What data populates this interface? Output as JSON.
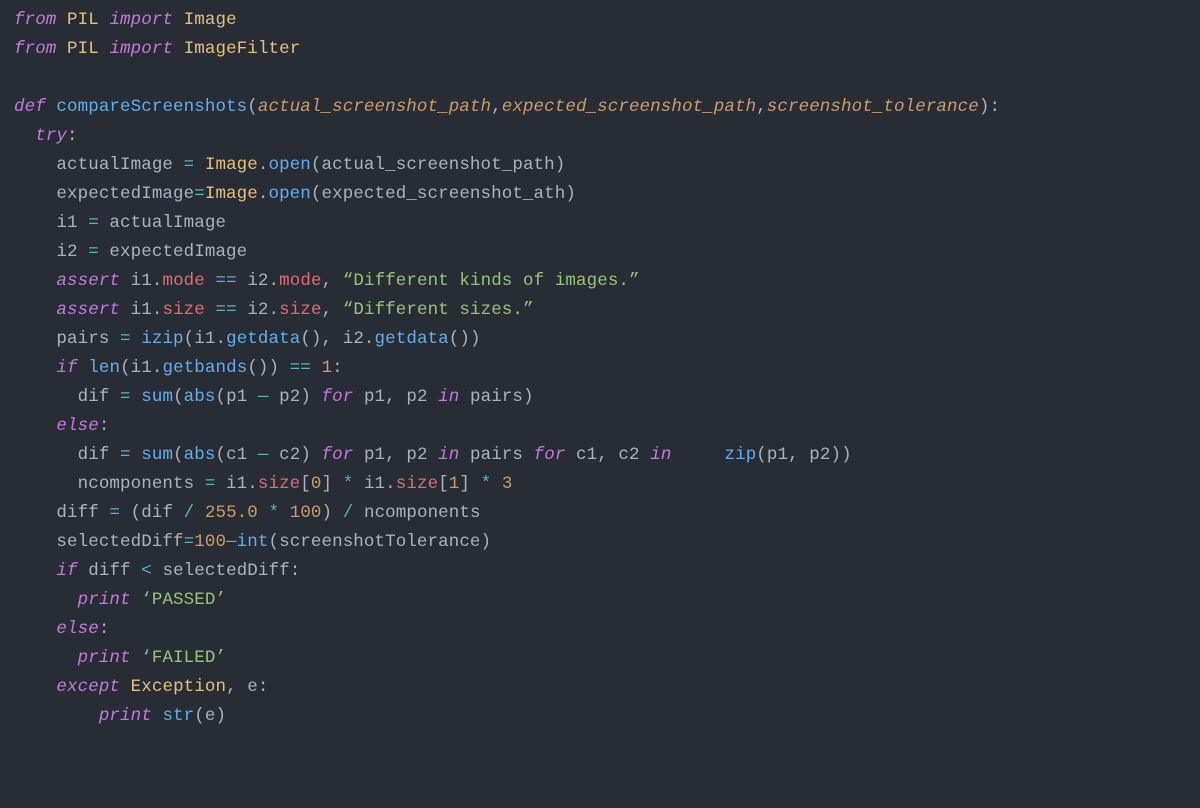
{
  "tokens": [
    [
      {
        "t": "from",
        "c": "kw"
      },
      {
        "t": " ",
        "c": "pl"
      },
      {
        "t": "PIL",
        "c": "cls"
      },
      {
        "t": " ",
        "c": "pl"
      },
      {
        "t": "import",
        "c": "kw"
      },
      {
        "t": " ",
        "c": "pl"
      },
      {
        "t": "Image",
        "c": "cls"
      }
    ],
    [
      {
        "t": "from",
        "c": "kw"
      },
      {
        "t": " ",
        "c": "pl"
      },
      {
        "t": "PIL",
        "c": "cls"
      },
      {
        "t": " ",
        "c": "pl"
      },
      {
        "t": "import",
        "c": "kw"
      },
      {
        "t": " ",
        "c": "pl"
      },
      {
        "t": "ImageFilter",
        "c": "cls"
      }
    ],
    [],
    [
      {
        "t": "def",
        "c": "kw"
      },
      {
        "t": " ",
        "c": "pl"
      },
      {
        "t": "compareScreenshots",
        "c": "fn"
      },
      {
        "t": "(",
        "c": "pl"
      },
      {
        "t": "actual_screenshot_path",
        "c": "prm"
      },
      {
        "t": ",",
        "c": "pl"
      },
      {
        "t": "expected_screenshot_path",
        "c": "prm"
      },
      {
        "t": ",",
        "c": "pl"
      },
      {
        "t": "screenshot_tolerance",
        "c": "prm"
      },
      {
        "t": "):",
        "c": "pl"
      }
    ],
    [
      {
        "t": "  ",
        "c": "pl"
      },
      {
        "t": "try",
        "c": "kw"
      },
      {
        "t": ":",
        "c": "pl"
      }
    ],
    [
      {
        "t": "    actualImage ",
        "c": "pl"
      },
      {
        "t": "=",
        "c": "op"
      },
      {
        "t": " ",
        "c": "pl"
      },
      {
        "t": "Image",
        "c": "cls"
      },
      {
        "t": ".",
        "c": "pl"
      },
      {
        "t": "open",
        "c": "fn"
      },
      {
        "t": "(actual_screenshot_path)",
        "c": "pl"
      }
    ],
    [
      {
        "t": "    expectedImage",
        "c": "pl"
      },
      {
        "t": "=",
        "c": "op"
      },
      {
        "t": "Image",
        "c": "cls"
      },
      {
        "t": ".",
        "c": "pl"
      },
      {
        "t": "open",
        "c": "fn"
      },
      {
        "t": "(expected_screenshot_ath)",
        "c": "pl"
      }
    ],
    [
      {
        "t": "    i1 ",
        "c": "pl"
      },
      {
        "t": "=",
        "c": "op"
      },
      {
        "t": " actualImage",
        "c": "pl"
      }
    ],
    [
      {
        "t": "    i2 ",
        "c": "pl"
      },
      {
        "t": "=",
        "c": "op"
      },
      {
        "t": " expectedImage",
        "c": "pl"
      }
    ],
    [
      {
        "t": "    ",
        "c": "pl"
      },
      {
        "t": "assert",
        "c": "kw"
      },
      {
        "t": " i1.",
        "c": "pl"
      },
      {
        "t": "mode",
        "c": "attr"
      },
      {
        "t": " ",
        "c": "pl"
      },
      {
        "t": "==",
        "c": "op"
      },
      {
        "t": " i2.",
        "c": "pl"
      },
      {
        "t": "mode",
        "c": "attr"
      },
      {
        "t": ", ",
        "c": "pl"
      },
      {
        "t": "“Different kinds of images.”",
        "c": "str"
      }
    ],
    [
      {
        "t": "    ",
        "c": "pl"
      },
      {
        "t": "assert",
        "c": "kw"
      },
      {
        "t": " i1.",
        "c": "pl"
      },
      {
        "t": "size",
        "c": "attr"
      },
      {
        "t": " ",
        "c": "pl"
      },
      {
        "t": "==",
        "c": "op"
      },
      {
        "t": " i2.",
        "c": "pl"
      },
      {
        "t": "size",
        "c": "attr"
      },
      {
        "t": ", ",
        "c": "pl"
      },
      {
        "t": "“Different sizes.”",
        "c": "str"
      }
    ],
    [
      {
        "t": "    pairs ",
        "c": "pl"
      },
      {
        "t": "=",
        "c": "op"
      },
      {
        "t": " ",
        "c": "pl"
      },
      {
        "t": "izip",
        "c": "fn"
      },
      {
        "t": "(i1.",
        "c": "pl"
      },
      {
        "t": "getdata",
        "c": "fn"
      },
      {
        "t": "(), i2.",
        "c": "pl"
      },
      {
        "t": "getdata",
        "c": "fn"
      },
      {
        "t": "())",
        "c": "pl"
      }
    ],
    [
      {
        "t": "    ",
        "c": "pl"
      },
      {
        "t": "if",
        "c": "kw"
      },
      {
        "t": " ",
        "c": "pl"
      },
      {
        "t": "len",
        "c": "fn"
      },
      {
        "t": "(i1.",
        "c": "pl"
      },
      {
        "t": "getbands",
        "c": "fn"
      },
      {
        "t": "()) ",
        "c": "pl"
      },
      {
        "t": "==",
        "c": "op"
      },
      {
        "t": " ",
        "c": "pl"
      },
      {
        "t": "1",
        "c": "num"
      },
      {
        "t": ":",
        "c": "pl"
      }
    ],
    [
      {
        "t": "      dif ",
        "c": "pl"
      },
      {
        "t": "=",
        "c": "op"
      },
      {
        "t": " ",
        "c": "pl"
      },
      {
        "t": "sum",
        "c": "fn"
      },
      {
        "t": "(",
        "c": "pl"
      },
      {
        "t": "abs",
        "c": "fn"
      },
      {
        "t": "(p1 ",
        "c": "pl"
      },
      {
        "t": "—",
        "c": "op"
      },
      {
        "t": " p2) ",
        "c": "pl"
      },
      {
        "t": "for",
        "c": "kw"
      },
      {
        "t": " p1, p2 ",
        "c": "pl"
      },
      {
        "t": "in",
        "c": "kw"
      },
      {
        "t": " pairs)",
        "c": "pl"
      }
    ],
    [
      {
        "t": "    ",
        "c": "pl"
      },
      {
        "t": "else",
        "c": "kw"
      },
      {
        "t": ":",
        "c": "pl"
      }
    ],
    [
      {
        "t": "      dif ",
        "c": "pl"
      },
      {
        "t": "=",
        "c": "op"
      },
      {
        "t": " ",
        "c": "pl"
      },
      {
        "t": "sum",
        "c": "fn"
      },
      {
        "t": "(",
        "c": "pl"
      },
      {
        "t": "abs",
        "c": "fn"
      },
      {
        "t": "(c1 ",
        "c": "pl"
      },
      {
        "t": "—",
        "c": "op"
      },
      {
        "t": " c2) ",
        "c": "pl"
      },
      {
        "t": "for",
        "c": "kw"
      },
      {
        "t": " p1, p2 ",
        "c": "pl"
      },
      {
        "t": "in",
        "c": "kw"
      },
      {
        "t": " pairs ",
        "c": "pl"
      },
      {
        "t": "for",
        "c": "kw"
      },
      {
        "t": " c1, c2 ",
        "c": "pl"
      },
      {
        "t": "in",
        "c": "kw"
      },
      {
        "t": "     ",
        "c": "pl"
      },
      {
        "t": "zip",
        "c": "fn"
      },
      {
        "t": "(p1, p2))",
        "c": "pl"
      }
    ],
    [
      {
        "t": "      ncomponents ",
        "c": "pl"
      },
      {
        "t": "=",
        "c": "op"
      },
      {
        "t": " i1.",
        "c": "pl"
      },
      {
        "t": "size",
        "c": "attr"
      },
      {
        "t": "[",
        "c": "pl"
      },
      {
        "t": "0",
        "c": "num"
      },
      {
        "t": "] ",
        "c": "pl"
      },
      {
        "t": "*",
        "c": "op"
      },
      {
        "t": " i1.",
        "c": "pl"
      },
      {
        "t": "size",
        "c": "attr"
      },
      {
        "t": "[",
        "c": "pl"
      },
      {
        "t": "1",
        "c": "num"
      },
      {
        "t": "] ",
        "c": "pl"
      },
      {
        "t": "*",
        "c": "op"
      },
      {
        "t": " ",
        "c": "pl"
      },
      {
        "t": "3",
        "c": "num"
      }
    ],
    [
      {
        "t": "    diff ",
        "c": "pl"
      },
      {
        "t": "=",
        "c": "op"
      },
      {
        "t": " (dif ",
        "c": "pl"
      },
      {
        "t": "/",
        "c": "op"
      },
      {
        "t": " ",
        "c": "pl"
      },
      {
        "t": "255.0",
        "c": "num"
      },
      {
        "t": " ",
        "c": "pl"
      },
      {
        "t": "*",
        "c": "op"
      },
      {
        "t": " ",
        "c": "pl"
      },
      {
        "t": "100",
        "c": "num"
      },
      {
        "t": ") ",
        "c": "pl"
      },
      {
        "t": "/",
        "c": "op"
      },
      {
        "t": " ncomponents",
        "c": "pl"
      }
    ],
    [
      {
        "t": "    selectedDiff",
        "c": "pl"
      },
      {
        "t": "=",
        "c": "op"
      },
      {
        "t": "100",
        "c": "num"
      },
      {
        "t": "—",
        "c": "op"
      },
      {
        "t": "int",
        "c": "fn"
      },
      {
        "t": "(screenshotTolerance)",
        "c": "pl"
      }
    ],
    [
      {
        "t": "    ",
        "c": "pl"
      },
      {
        "t": "if",
        "c": "kw"
      },
      {
        "t": " diff ",
        "c": "pl"
      },
      {
        "t": "<",
        "c": "op"
      },
      {
        "t": " selectedDiff:",
        "c": "pl"
      }
    ],
    [
      {
        "t": "      ",
        "c": "pl"
      },
      {
        "t": "print",
        "c": "kw"
      },
      {
        "t": " ",
        "c": "pl"
      },
      {
        "t": "‘PASSED’",
        "c": "str"
      }
    ],
    [
      {
        "t": "    ",
        "c": "pl"
      },
      {
        "t": "else",
        "c": "kw"
      },
      {
        "t": ":",
        "c": "pl"
      }
    ],
    [
      {
        "t": "      ",
        "c": "pl"
      },
      {
        "t": "print",
        "c": "kw"
      },
      {
        "t": " ",
        "c": "pl"
      },
      {
        "t": "‘FAILED’",
        "c": "str"
      }
    ],
    [
      {
        "t": "    ",
        "c": "pl"
      },
      {
        "t": "except",
        "c": "kw"
      },
      {
        "t": " ",
        "c": "pl"
      },
      {
        "t": "Exception",
        "c": "cls"
      },
      {
        "t": ", e:",
        "c": "pl"
      }
    ],
    [
      {
        "t": "        ",
        "c": "pl"
      },
      {
        "t": "print",
        "c": "kw"
      },
      {
        "t": " ",
        "c": "pl"
      },
      {
        "t": "str",
        "c": "fn"
      },
      {
        "t": "(e)",
        "c": "pl"
      }
    ]
  ]
}
